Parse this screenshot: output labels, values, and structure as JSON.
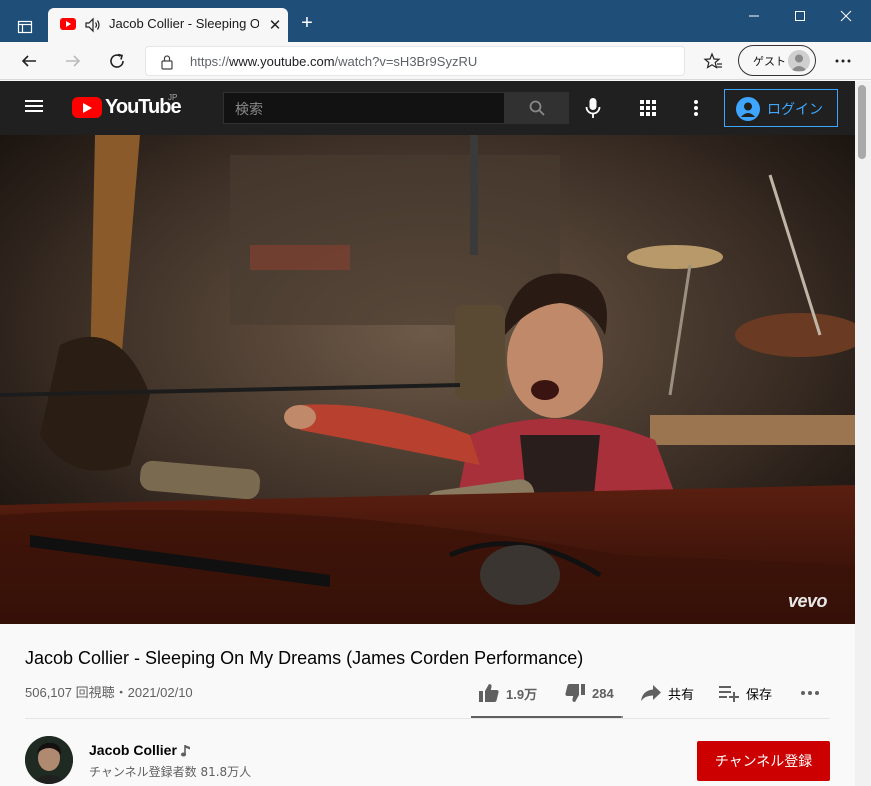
{
  "browser": {
    "tab_title": "Jacob Collier - Sleeping On",
    "url_prefix": "https://",
    "url_host": "www.youtube.com",
    "url_path": "/watch?v=sH3Br9SyzRU",
    "guest_label": "ゲスト",
    "icons": [
      "tab-actions-icon",
      "youtube-favicon",
      "speaker-icon",
      "close-icon",
      "plus-icon",
      "minimize-icon",
      "maximize-icon",
      "close-window-icon",
      "back-icon",
      "forward-icon",
      "refresh-icon",
      "lock-icon",
      "favorites-icon",
      "guest-avatar-icon",
      "more-icon"
    ]
  },
  "youtube": {
    "logo_text": "YouTube",
    "logo_region": "JP",
    "search_placeholder": "検索",
    "login_label": "ログイン",
    "icons": [
      "menu-icon",
      "search-icon",
      "mic-icon",
      "apps-icon",
      "more-vert-icon",
      "account-icon"
    ]
  },
  "video": {
    "watermark": "vevo",
    "title": "Jacob Collier - Sleeping On My Dreams (James Corden Performance)",
    "meta": "506,107 回視聴・2021/02/10",
    "likes": "1.9万",
    "dislikes": "284",
    "share_label": "共有",
    "save_label": "保存",
    "like_ratio": 0.985
  },
  "channel": {
    "name": "Jacob Collier",
    "subscribers": "チャンネル登録者数 81.8万人",
    "subscribe_label": "チャンネル登録"
  },
  "colors": {
    "titlebar": "#1f4e79",
    "yt_red": "#ff0000",
    "subscribe": "#cc0000",
    "login_blue": "#3ea6ff"
  }
}
